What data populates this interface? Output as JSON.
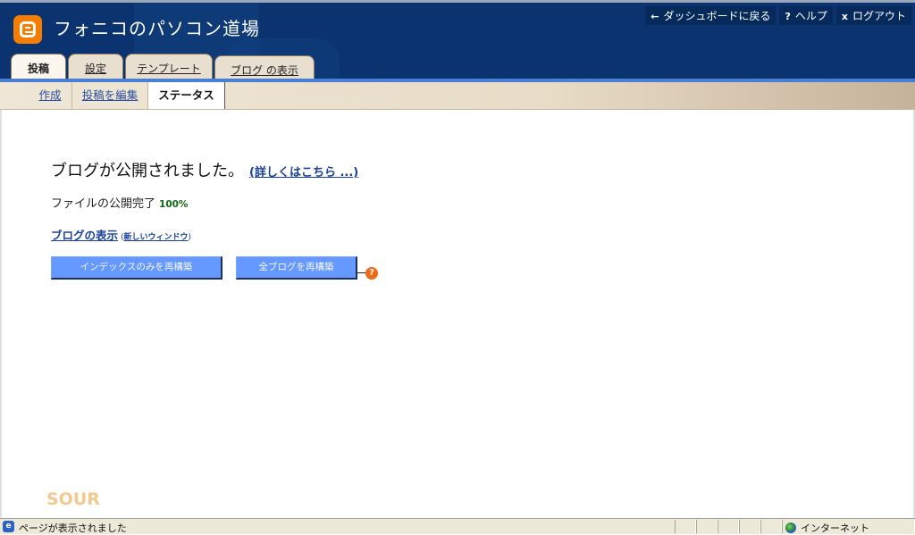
{
  "header": {
    "title": "フォニコのパソコン道場",
    "logo_icon": "blogger-logo-icon",
    "brand_color": "#f57d00",
    "links": [
      {
        "icon": "←",
        "label": "ダッシュボードに戻る"
      },
      {
        "icon": "?",
        "label": "ヘルプ"
      },
      {
        "icon": "x",
        "label": "ログアウト"
      }
    ]
  },
  "tabs": [
    {
      "label": "投稿"
    },
    {
      "label": "設定"
    },
    {
      "label": "テンプレート"
    },
    {
      "label": "ブログ の表示"
    }
  ],
  "subnav": [
    {
      "label": "作成"
    },
    {
      "label": "投稿を編集"
    },
    {
      "label": "ステータス"
    }
  ],
  "main": {
    "heading": "ブログが公開されました。",
    "details_link": "(詳しくはこちら ...)",
    "publish_label": "ファイルの公開完了",
    "publish_percent": "100%",
    "view_blog_link": "ブログの表示",
    "new_window_open": "(",
    "new_window_link": "新しいウィンドウ",
    "new_window_close": ")",
    "rebuild_index_button": "インデックスのみを再構築",
    "rebuild_all_button": "全ブログを再構築",
    "help_icon": "?"
  },
  "watermark": "SOUR",
  "statusbar": {
    "text": "ページが表示されました",
    "zone": "インターネット"
  }
}
